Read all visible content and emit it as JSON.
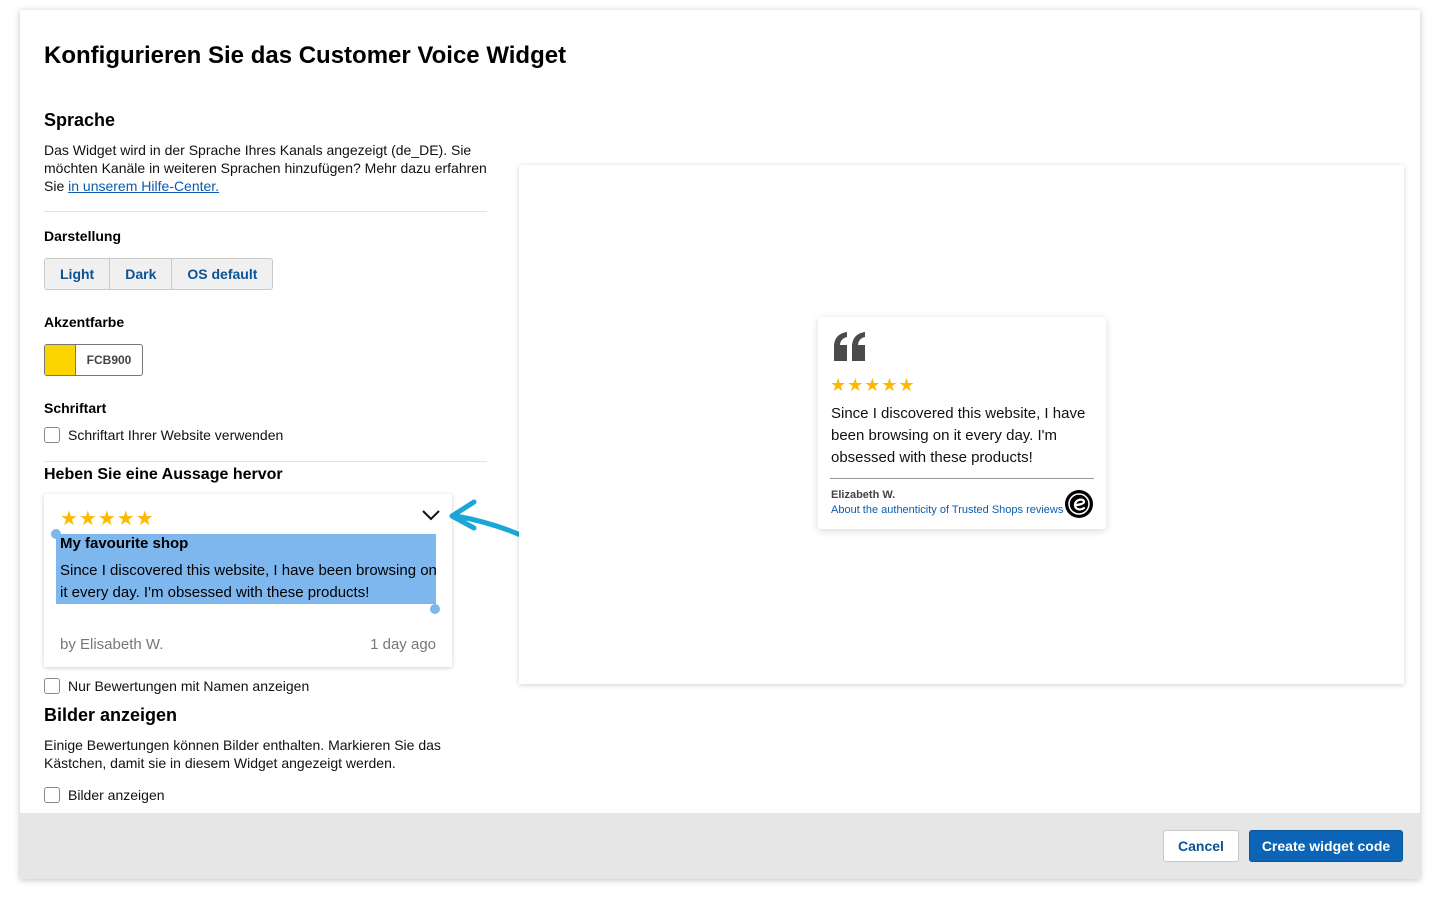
{
  "dialog": {
    "title": "Konfigurieren Sie das Customer Voice Widget"
  },
  "language": {
    "heading": "Sprache",
    "description": "Das Widget wird in der Sprache Ihres Kanals angezeigt (de_DE). Sie möchten Kanäle in weiteren Sprachen hinzufügen? Mehr dazu erfahren Sie",
    "link": "in unserem Hilfe-Center."
  },
  "appearance": {
    "heading": "Darstellung",
    "options": [
      "Light",
      "Dark",
      "OS default"
    ]
  },
  "accent": {
    "heading": "Akzentfarbe",
    "hex": "FCB900",
    "color": "#fcd400"
  },
  "font": {
    "heading": "Schriftart",
    "checkbox_label": "Schriftart Ihrer Website verwenden"
  },
  "highlight": {
    "heading": "Heben Sie eine Aussage hervor",
    "stars": "★★★★★",
    "review_title": "My favourite shop",
    "review_text": "Since I discovered this website, I have been browsing on it every day. I'm obsessed with these products!",
    "author": "by Elisabeth W.",
    "time": "1 day ago",
    "names_only_label": "Nur Bewertungen mit Namen anzeigen"
  },
  "images": {
    "heading": "Bilder anzeigen",
    "description": "Einige Bewertungen können Bilder enthalten. Markieren Sie das Kästchen, damit sie in diesem Widget angezeigt werden.",
    "checkbox_label": "Bilder anzeigen"
  },
  "preview": {
    "stars": "★★★★★",
    "text": "Since I discovered this website, I have been browsing on it every day. I'm obsessed with these products!",
    "author": "Elizabeth W.",
    "link": "About the authenticity of Trusted Shops reviews"
  },
  "footer": {
    "cancel": "Cancel",
    "create": "Create widget code"
  },
  "colors": {
    "accent_blue": "#0b64b5",
    "star_yellow": "#fcb900",
    "selection": "#7db7ee",
    "annotation_arrow": "#1aa7d8"
  }
}
